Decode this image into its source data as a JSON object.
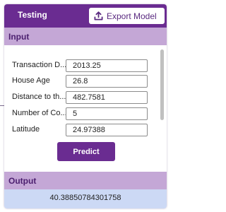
{
  "panel": {
    "title": "Testing",
    "export_label": "Export Model",
    "export_icon": "upload-icon"
  },
  "input_section": {
    "title": "Input",
    "fields": [
      {
        "label": "Transaction D...",
        "value": "2013.25"
      },
      {
        "label": "House Age",
        "value": "26.8"
      },
      {
        "label": "Distance to th...",
        "value": "482.7581"
      },
      {
        "label": "Number of Co...",
        "value": "5"
      },
      {
        "label": "Latitude",
        "value": "24.97388"
      }
    ],
    "predict_label": "Predict"
  },
  "output_section": {
    "title": "Output",
    "value": "40.38850784301758"
  },
  "colors": {
    "accent": "#6a2c91",
    "section_bar": "#c4a7d6",
    "output_background": "#ccd9f5"
  }
}
